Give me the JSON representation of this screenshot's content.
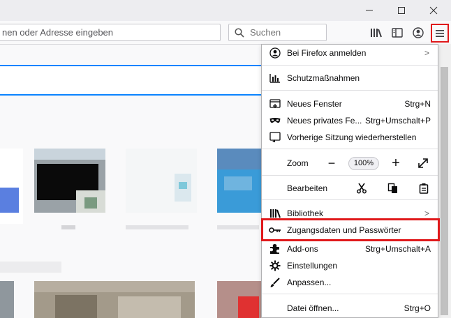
{
  "window": {
    "minimize_icon": "minimize-icon",
    "maximize_icon": "maximize-icon",
    "close_icon": "close-icon"
  },
  "toolbar": {
    "url_placeholder": "Suchbegriff eingeben oder Adresse eingeben",
    "url_visible_text": "nen oder Adresse eingeben",
    "search_placeholder": "Suchen",
    "accent": "#e0191b"
  },
  "menu": {
    "sign_in": "Bei Firefox anmelden",
    "protections": "Schutzmaßnahmen",
    "new_window": {
      "label": "Neues Fenster",
      "shortcut": "Strg+N"
    },
    "new_private": {
      "label": "Neues privates Fe...",
      "shortcut": "Strg+Umschalt+P"
    },
    "restore_session": "Vorherige Sitzung wiederherstellen",
    "zoom": {
      "label": "Zoom",
      "minus": "−",
      "value": "100%",
      "plus": "+"
    },
    "edit": {
      "label": "Bearbeiten"
    },
    "library": "Bibliothek",
    "passwords": "Zugangsdaten und Passwörter",
    "addons": {
      "label": "Add-ons",
      "shortcut": "Strg+Umschalt+A"
    },
    "settings": "Einstellungen",
    "customize": "Anpassen...",
    "open_file": {
      "label": "Datei öffnen...",
      "shortcut": "Strg+O"
    }
  }
}
